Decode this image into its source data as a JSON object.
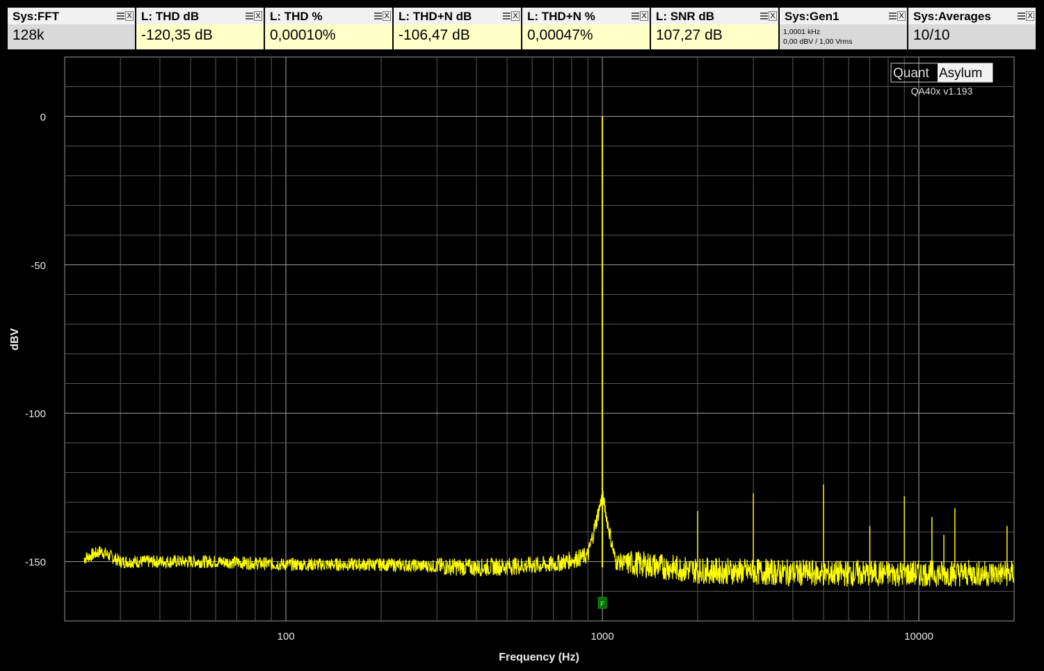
{
  "tiles": [
    {
      "title": "Sys:FFT",
      "value": "128k",
      "bg": "gray"
    },
    {
      "title": "L: THD dB",
      "value": "-120,35 dB",
      "bg": "yellow"
    },
    {
      "title": "L: THD %",
      "value": "0,00010%",
      "bg": "yellow"
    },
    {
      "title": "L: THD+N dB",
      "value": "-106,47 dB",
      "bg": "yellow"
    },
    {
      "title": "L: THD+N %",
      "value": "0,00047%",
      "bg": "yellow"
    },
    {
      "title": "L: SNR dB",
      "value": "107,27 dB",
      "bg": "yellow"
    },
    {
      "title": "Sys:Gen1",
      "line1": "1,0001 kHz",
      "line2": "0,00 dBV  / 1,00 Vrms",
      "bg": "gray"
    },
    {
      "title": "Sys:Averages",
      "value": "10/10",
      "bg": "gray"
    }
  ],
  "tile_menu_icon": "menu-lines-icon",
  "tile_close_label": "X",
  "logo": {
    "left": "Quant",
    "right": "Asylum",
    "version": "QA40x v1.193"
  },
  "chart_data": {
    "type": "line",
    "xlabel": "Frequency (Hz)",
    "ylabel": "dBV",
    "xscale": "log",
    "xlim": [
      20,
      20000
    ],
    "ylim": [
      -170,
      20
    ],
    "xticks": [
      {
        "value": 100,
        "label": "100"
      },
      {
        "value": 1000,
        "label": "1000"
      },
      {
        "value": 10000,
        "label": "10000"
      }
    ],
    "yticks": [
      {
        "value": 0,
        "label": "0"
      },
      {
        "value": -50,
        "label": "-50"
      },
      {
        "value": -100,
        "label": "-100"
      },
      {
        "value": -150,
        "label": "-150"
      }
    ],
    "grid": true,
    "line_color": "#ffff00",
    "noise_floor": [
      [
        23,
        -149
      ],
      [
        26,
        -146.5
      ],
      [
        30,
        -150
      ],
      [
        40,
        -150
      ],
      [
        60,
        -150
      ],
      [
        100,
        -151
      ],
      [
        200,
        -151
      ],
      [
        400,
        -152
      ],
      [
        700,
        -151
      ],
      [
        900,
        -148
      ],
      [
        1000,
        -128
      ],
      [
        1100,
        -150
      ],
      [
        2000,
        -153
      ],
      [
        5000,
        -154
      ],
      [
        10000,
        -154
      ],
      [
        20000,
        -154
      ]
    ],
    "peaks": [
      {
        "freq": 1000,
        "level": 0
      },
      {
        "freq": 2000,
        "level": -133
      },
      {
        "freq": 3000,
        "level": -127
      },
      {
        "freq": 5000,
        "level": -124
      },
      {
        "freq": 7000,
        "level": -138
      },
      {
        "freq": 9000,
        "level": -128
      },
      {
        "freq": 11000,
        "level": -135
      },
      {
        "freq": 12000,
        "level": -141
      },
      {
        "freq": 13000,
        "level": -132
      },
      {
        "freq": 19000,
        "level": -138
      }
    ],
    "marker": {
      "freq": 1000,
      "label": "F",
      "color": "#0a6a0a"
    }
  }
}
